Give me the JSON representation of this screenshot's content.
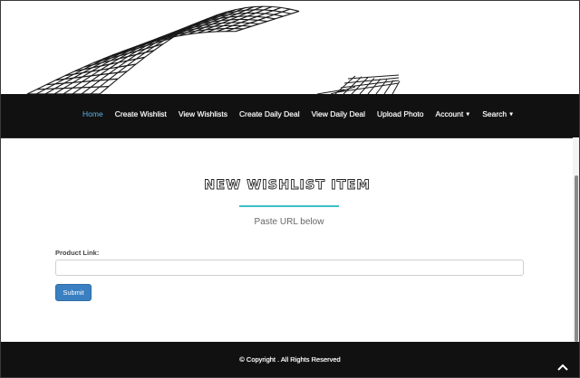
{
  "nav": {
    "items": [
      {
        "label": "Home",
        "active": true
      },
      {
        "label": "Create Wishlist",
        "active": false
      },
      {
        "label": "View Wishlists",
        "active": false
      },
      {
        "label": "Create Daily Deal",
        "active": false
      },
      {
        "label": "View Daily Deal",
        "active": false
      },
      {
        "label": "Upload Photo",
        "active": false
      },
      {
        "label": "Account",
        "active": false,
        "dropdown": true
      },
      {
        "label": "Search",
        "active": false,
        "dropdown": true
      }
    ]
  },
  "main": {
    "title": "NEW WISHLIST ITEM",
    "subtitle": "Paste URL below",
    "form": {
      "label": "Product Link:",
      "value": "",
      "placeholder": "",
      "submit_label": "Submit"
    }
  },
  "footer": {
    "text": "© Copyright . All Rights Reserved"
  },
  "colors": {
    "accent": "#3cc0c4",
    "active_link": "#5ab4e8",
    "button": "#3a7fc1",
    "navbar": "#111111"
  },
  "icons": {
    "back_to_top": "chevron-up-icon"
  }
}
